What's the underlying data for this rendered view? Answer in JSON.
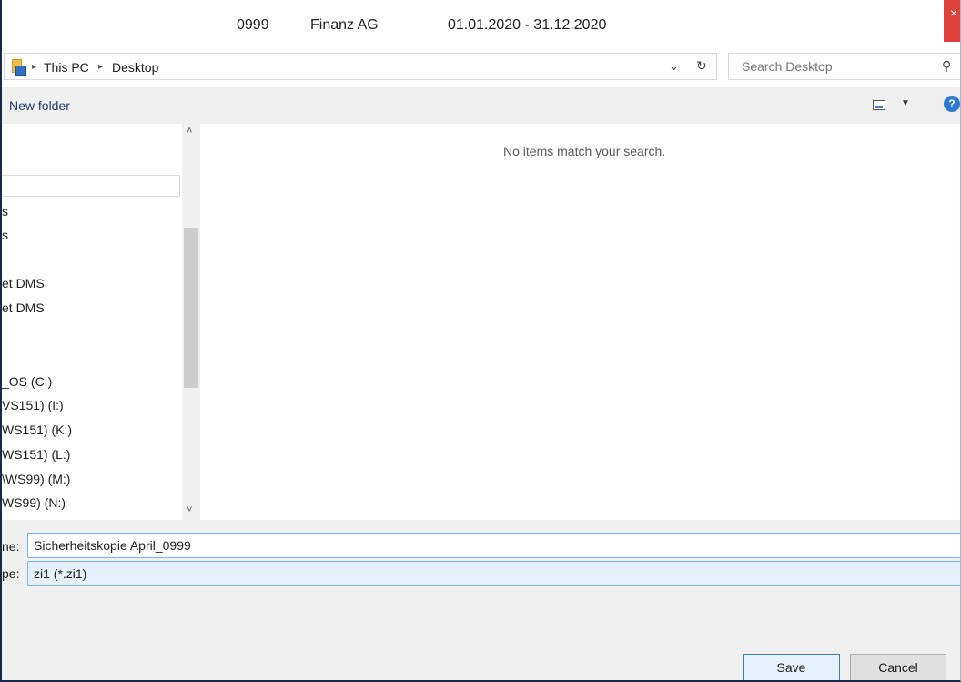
{
  "window": {
    "title_segments": [
      "0999",
      "Finanz AG",
      "01.01.2020 - 31.12.2020"
    ],
    "close_glyph": "×"
  },
  "address": {
    "crumbs": [
      "This PC",
      "Desktop"
    ],
    "separator": "▸",
    "dropdown_glyph": "⌄",
    "refresh_glyph": "↻",
    "icon": "folder-icon"
  },
  "search": {
    "placeholder": "Search Desktop",
    "icon": "search-icon",
    "icon_glyph": "⚲"
  },
  "toolbar": {
    "new_folder_label": "New folder",
    "view_dropdown_glyph": "▼",
    "help_glyph": "?"
  },
  "nav": {
    "items": [
      "s",
      "s",
      "et DMS",
      "et DMS",
      "_OS (C:)",
      "VS151) (I:)",
      "WS151) (K:)",
      "WS151) (L:)",
      "\\WS99) (M:)",
      "WS99) (N:)"
    ],
    "scroll_up_glyph": "˄",
    "scroll_down_glyph": "˅"
  },
  "file_list": {
    "empty_message": "No items match your search."
  },
  "save_form": {
    "filename_label": "ne:",
    "filename_value": "Sicherheitskopie April_0999",
    "filetype_label": "pe:",
    "filetype_value": "zi1  (*.zi1)",
    "dropdown_glyph": "⌄"
  },
  "buttons": {
    "save_label": "Save",
    "cancel_label": "Cancel"
  },
  "colors": {
    "close_red": "#e0403a",
    "field_border_blue": "#7eb4ea",
    "save_border": "#3c7fb1",
    "help_blue": "#2f7ad0"
  }
}
